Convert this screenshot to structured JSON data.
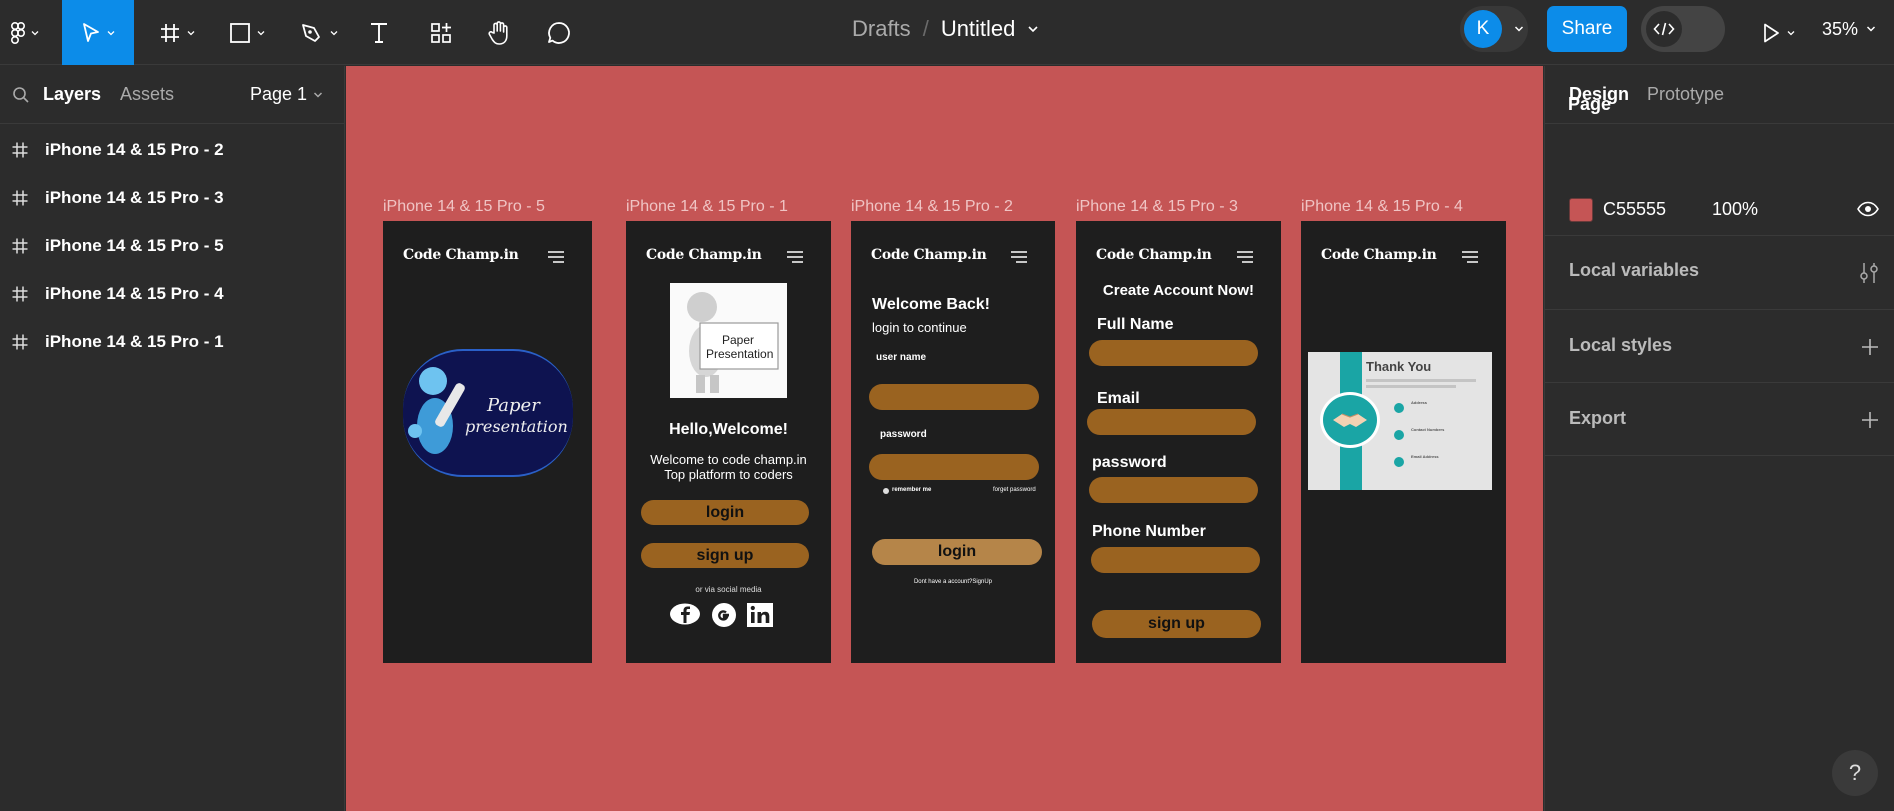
{
  "toolbar": {
    "breadcrumb_parent": "Drafts",
    "breadcrumb_separator": "/",
    "file_title": "Untitled",
    "user_initial": "K",
    "share_label": "Share",
    "zoom_level": "35%",
    "accent_color": "#0c8ce9"
  },
  "left_panel": {
    "tab_layers": "Layers",
    "tab_assets": "Assets",
    "page_selector": "Page 1",
    "layers": [
      {
        "label": "iPhone 14 & 15 Pro - 2"
      },
      {
        "label": "iPhone 14 & 15 Pro - 3"
      },
      {
        "label": "iPhone 14 & 15 Pro - 5"
      },
      {
        "label": "iPhone 14 & 15 Pro - 4"
      },
      {
        "label": "iPhone 14 & 15 Pro - 1"
      }
    ]
  },
  "canvas": {
    "background_color": "#C55555",
    "frames": [
      {
        "label": "iPhone 14 & 15 Pro - 5",
        "logo": "Code Champ.in",
        "image_text_line1": "Paper",
        "image_text_line2": "presentation"
      },
      {
        "label": "iPhone 14 & 15 Pro - 1",
        "logo": "Code Champ.in",
        "image_text_line1": "Paper",
        "image_text_line2": "Presentation",
        "heading": "Hello,Welcome!",
        "subtitle_line1": "Welcome to code champ.in",
        "subtitle_line2": "Top platform to coders",
        "login_button": "login",
        "signup_button": "sign up",
        "social_caption": "or via social media"
      },
      {
        "label": "iPhone 14 & 15 Pro - 2",
        "logo": "Code Champ.in",
        "heading": "Welcome Back!",
        "subtitle": "login to continue",
        "username_label": "user name",
        "password_label": "password",
        "remember_me": "remember me",
        "forget_password": "forget password",
        "login_button": "login",
        "signup_prompt": "Dont have a account?SignUp"
      },
      {
        "label": "iPhone 14 & 15 Pro - 3",
        "logo": "Code Champ.in",
        "heading": "Create Account Now!",
        "fullname_label": "Full Name",
        "email_label": "Email",
        "password_label": "password",
        "phone_label": "Phone Number",
        "signup_button": "sign up"
      },
      {
        "label": "iPhone 14 & 15 Pro - 4",
        "logo": "Code Champ.in",
        "card_title": "Thank You",
        "card_item1": "Address",
        "card_item2": "Contact Numbers",
        "card_item3": "Email Address"
      }
    ],
    "button_color": "#9a6320"
  },
  "right_panel": {
    "tab_design": "Design",
    "tab_prototype": "Prototype",
    "page_heading": "Page",
    "page_color_hex": "C55555",
    "page_color_opacity": "100%",
    "local_variables": "Local variables",
    "local_styles": "Local styles",
    "export": "Export"
  },
  "help_label": "?"
}
